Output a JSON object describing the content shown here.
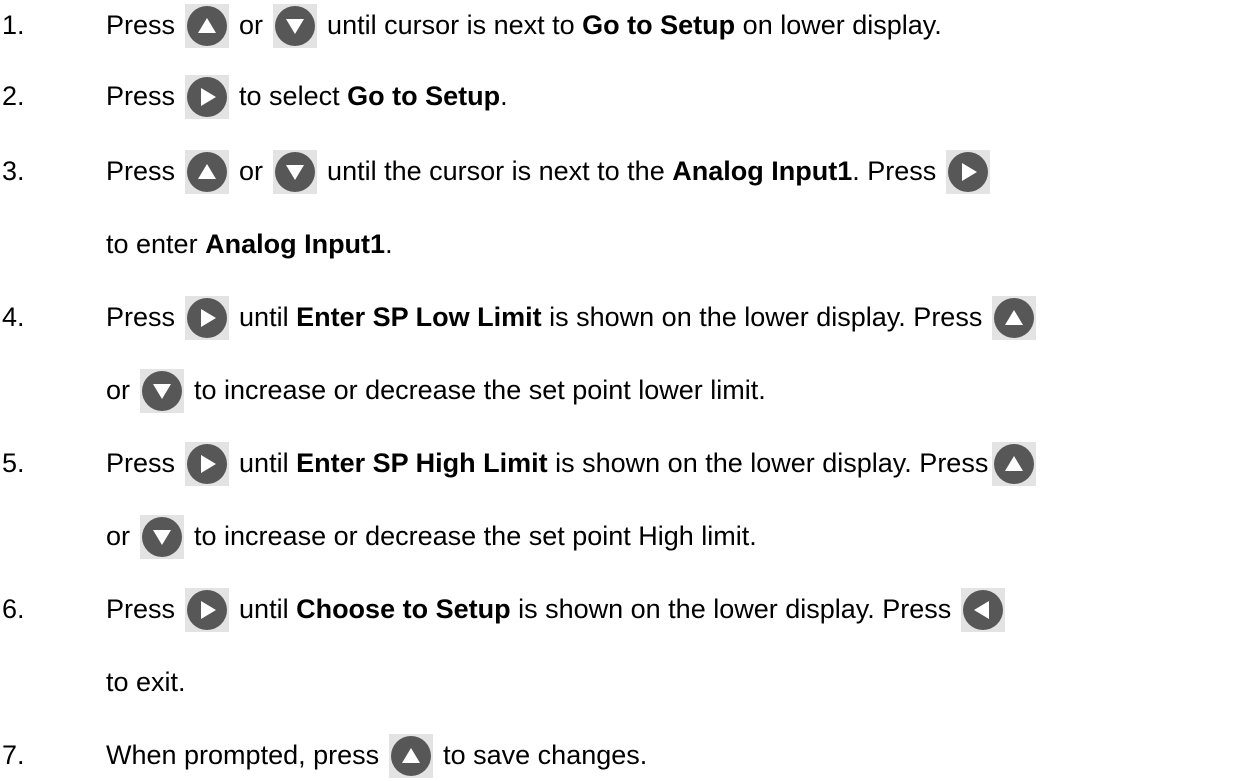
{
  "colors": {
    "button_face": "#575757",
    "button_tile": "#e3e3e3",
    "glyph": "#ffffff"
  },
  "icons": {
    "up": "up-arrow-button-icon",
    "down": "down-arrow-button-icon",
    "right": "right-arrow-button-icon",
    "left": "left-arrow-button-icon"
  },
  "steps": [
    {
      "num": "1.",
      "t1": "Press",
      "t2": "or",
      "t3": "until cursor is next to",
      "b1": "Go to Setup",
      "t4": "on lower display."
    },
    {
      "num": "2.",
      "t1": "Press",
      "t2": "to select",
      "b1": "Go to Setup",
      "t3": "."
    },
    {
      "num": "3.",
      "t1": "Press",
      "t2": "or",
      "t3": "until the cursor is next to the",
      "b1": "Analog Input1",
      "t4": ".  Press",
      "t5": "to enter",
      "b2": "Analog Input1",
      "t6": "."
    },
    {
      "num": "4.",
      "t1": "Press",
      "t2": "until",
      "b1": "Enter SP Low Limit",
      "t3": "is shown on the lower display.  Press",
      "t4": "or",
      "t5": "to increase or decrease the set point lower limit."
    },
    {
      "num": "5.",
      "t1": "Press",
      "t2": "until",
      "b1": "Enter SP High Limit",
      "t3": "is shown on the lower display.  Press",
      "t4": "or",
      "t5": "to increase or decrease the set point High limit."
    },
    {
      "num": "6.",
      "t1": "Press",
      "t2": "until",
      "b1": "Choose to Setup",
      "t3": "is shown on the lower display.  Press",
      "t4": "to exit."
    },
    {
      "num": "7.",
      "t1": "When prompted, press",
      "t2": "to save changes."
    }
  ]
}
